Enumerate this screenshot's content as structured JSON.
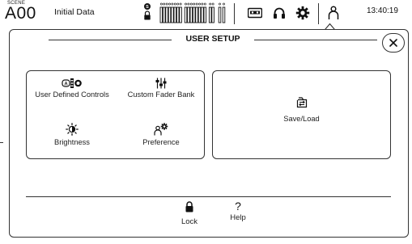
{
  "status_bar": {
    "scene_label": "SCENE",
    "scene_number": "A00",
    "scene_title": "Initial Data",
    "clock": "13:40:19",
    "icons": [
      "security-lock-icon",
      "level-meters",
      "recorder-icon",
      "headphones-icon",
      "settings-gear-icon",
      "user-icon"
    ]
  },
  "dialog": {
    "title": "USER SETUP",
    "close_icon": "close-x-icon",
    "left_panel": {
      "items": [
        {
          "label": "User Defined Controls",
          "icon": "user-defined-controls-icon"
        },
        {
          "label": "Custom Fader Bank",
          "icon": "fader-bank-icon"
        },
        {
          "label": "Brightness",
          "icon": "brightness-icon"
        },
        {
          "label": "Preference",
          "icon": "preference-icon"
        }
      ]
    },
    "right_panel": {
      "label": "Save/Load",
      "icon": "save-load-icon"
    },
    "bottom": {
      "lock_label": "Lock",
      "help_label": "Help",
      "help_glyph": "?"
    }
  },
  "colors": {
    "foreground": "#1a1a1a",
    "background": "#ffffff",
    "border": "#333333"
  }
}
